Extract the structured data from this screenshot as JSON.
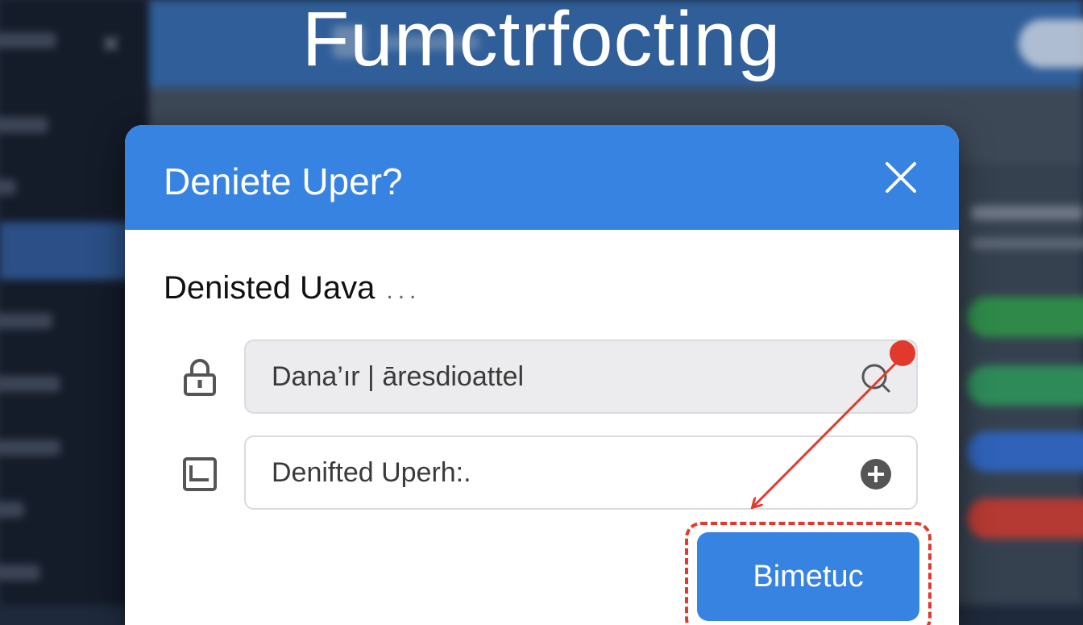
{
  "headline": "Fumctrfocting",
  "dialog": {
    "title": "Deniete Uper?",
    "subtitle": "Denisted Uava",
    "subtitle_ellipsis": "...",
    "fields": [
      {
        "value": "Dana’ır | āresdioattel",
        "icon": "lock-icon",
        "trailing_icon": "search-icon"
      },
      {
        "placeholder": "Denifted Uperh:.",
        "icon": "card-icon",
        "trailing_icon": "add-circle-icon"
      }
    ],
    "submit_label": "Bimetuc"
  },
  "colors": {
    "accent": "#3683e1",
    "annotation": "#e2392d",
    "background_sidebar": "#141b29",
    "background_header": "#2f5e99"
  }
}
